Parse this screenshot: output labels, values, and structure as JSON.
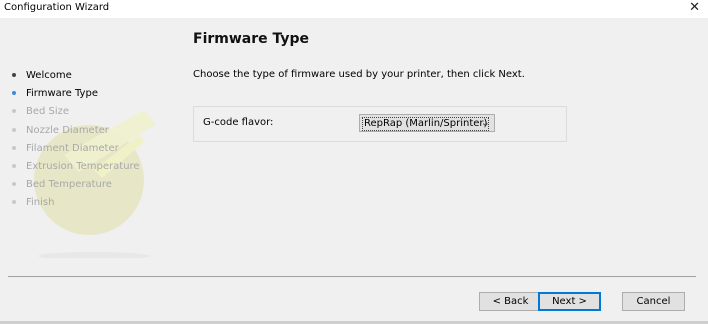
{
  "window": {
    "title": "Configuration Wizard",
    "close_glyph": "✕"
  },
  "sidebar": {
    "steps": [
      {
        "label": "Welcome",
        "state": "done"
      },
      {
        "label": "Firmware Type",
        "state": "active"
      },
      {
        "label": "Bed Size",
        "state": "pending"
      },
      {
        "label": "Nozzle Diameter",
        "state": "pending"
      },
      {
        "label": "Filament Diameter",
        "state": "pending"
      },
      {
        "label": "Extrusion Temperature",
        "state": "pending"
      },
      {
        "label": "Bed Temperature",
        "state": "pending"
      },
      {
        "label": "Finish",
        "state": "pending"
      }
    ]
  },
  "page": {
    "title": "Firmware Type",
    "description": "Choose the type of firmware used by your printer, then click Next.",
    "gcode_flavor": {
      "label": "G-code flavor:",
      "value": "RepRap (Marlin/Sprinter)"
    }
  },
  "buttons": {
    "back": "< Back",
    "next": "Next >",
    "cancel": "Cancel"
  },
  "colors": {
    "accent": "#0078d7",
    "active_bullet": "#3a8be0",
    "logo": "#e3e3b8"
  }
}
